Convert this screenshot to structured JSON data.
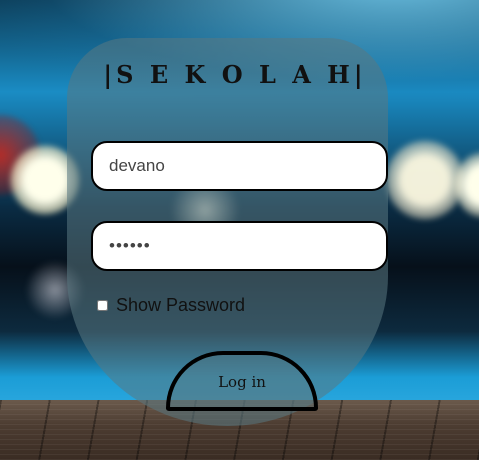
{
  "app": {
    "title": "|S E K O L A H|"
  },
  "form": {
    "username_value": "devano",
    "password_value": "devano",
    "password_placeholder": "",
    "username_placeholder": "",
    "show_password_label": "Show Password",
    "show_password_checked": false,
    "login_label": "Log in"
  },
  "colors": {
    "card": "#5a7882",
    "field_background": "#ffffff",
    "border": "#000000",
    "text": "#111111"
  }
}
